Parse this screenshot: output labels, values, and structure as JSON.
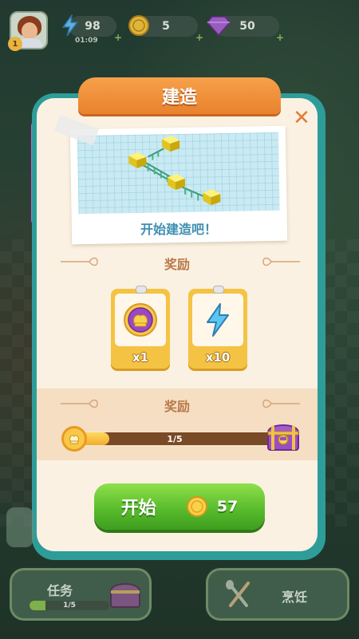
{
  "hud": {
    "player_level": "1",
    "energy": "98",
    "energy_timer": "01:09",
    "coins": "5",
    "gems": "50",
    "plus": "+"
  },
  "dialog": {
    "title": "建造",
    "close_icon": "close-icon",
    "preview_caption": "开始建造吧！",
    "rewards_label": "奖励",
    "rewards": [
      {
        "icon": "chef-hat-coin-icon",
        "quantity": "x1"
      },
      {
        "icon": "energy-bolt-icon",
        "quantity": "x10"
      }
    ],
    "milestone_label": "奖励",
    "milestone_progress_text": "1/5",
    "milestone_progress": 0.2,
    "start_button": {
      "label": "开始",
      "cost": "57",
      "cost_icon": "coin-icon"
    }
  },
  "bottom_bar": {
    "quest_label": "任务",
    "quest_progress_text": "1/5",
    "quest_progress": 0.2,
    "cook_label": "烹饪"
  },
  "colors": {
    "dialog_frame": "#2e9d9a",
    "dialog_bg": "#fbf1e2",
    "title_tab": "#e8822e",
    "start_button": "#56b92b",
    "reward_card": "#f4c343"
  }
}
